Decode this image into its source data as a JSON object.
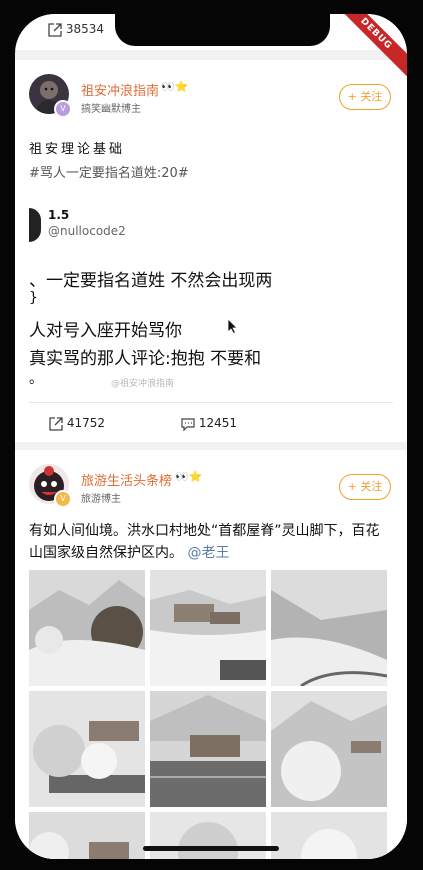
{
  "top": {
    "share_count": "38534"
  },
  "post1": {
    "username": "祖安冲浪指南",
    "badge_emoji": "👀⭐",
    "user_tag": "搞笑幽默博主",
    "follow_label": "+ 关注",
    "title": "祖安理论基础",
    "hashtag": "#骂人一定要指名道姓:20#",
    "embed": {
      "name": "1.5",
      "handle": "@nullocode2",
      "lines": [
        "、一定要指名道姓 不然会出现两",
        "}",
        "人对号入座开始骂你",
        "真实骂的那人评论:抱抱 不要和",
        "。"
      ]
    },
    "watermark": "@祖安冲浪指南",
    "shares": "41752",
    "comments": "12451"
  },
  "post2": {
    "username": "旅游生活头条榜",
    "badge_emoji": "👀⭐",
    "user_tag": "旅游博主",
    "follow_label": "+ 关注",
    "text": "有如人间仙境。洪水口村地处“首都屋脊”灵山脚下，百花山国家级自然保护区内。",
    "mention": "@老王"
  },
  "debug_label": "DEBUG",
  "colors": {
    "accent_orange": "#f0a02f",
    "username_orange": "#e06d38",
    "link_blue": "#5b7ea6",
    "debug_red": "#c62828"
  }
}
